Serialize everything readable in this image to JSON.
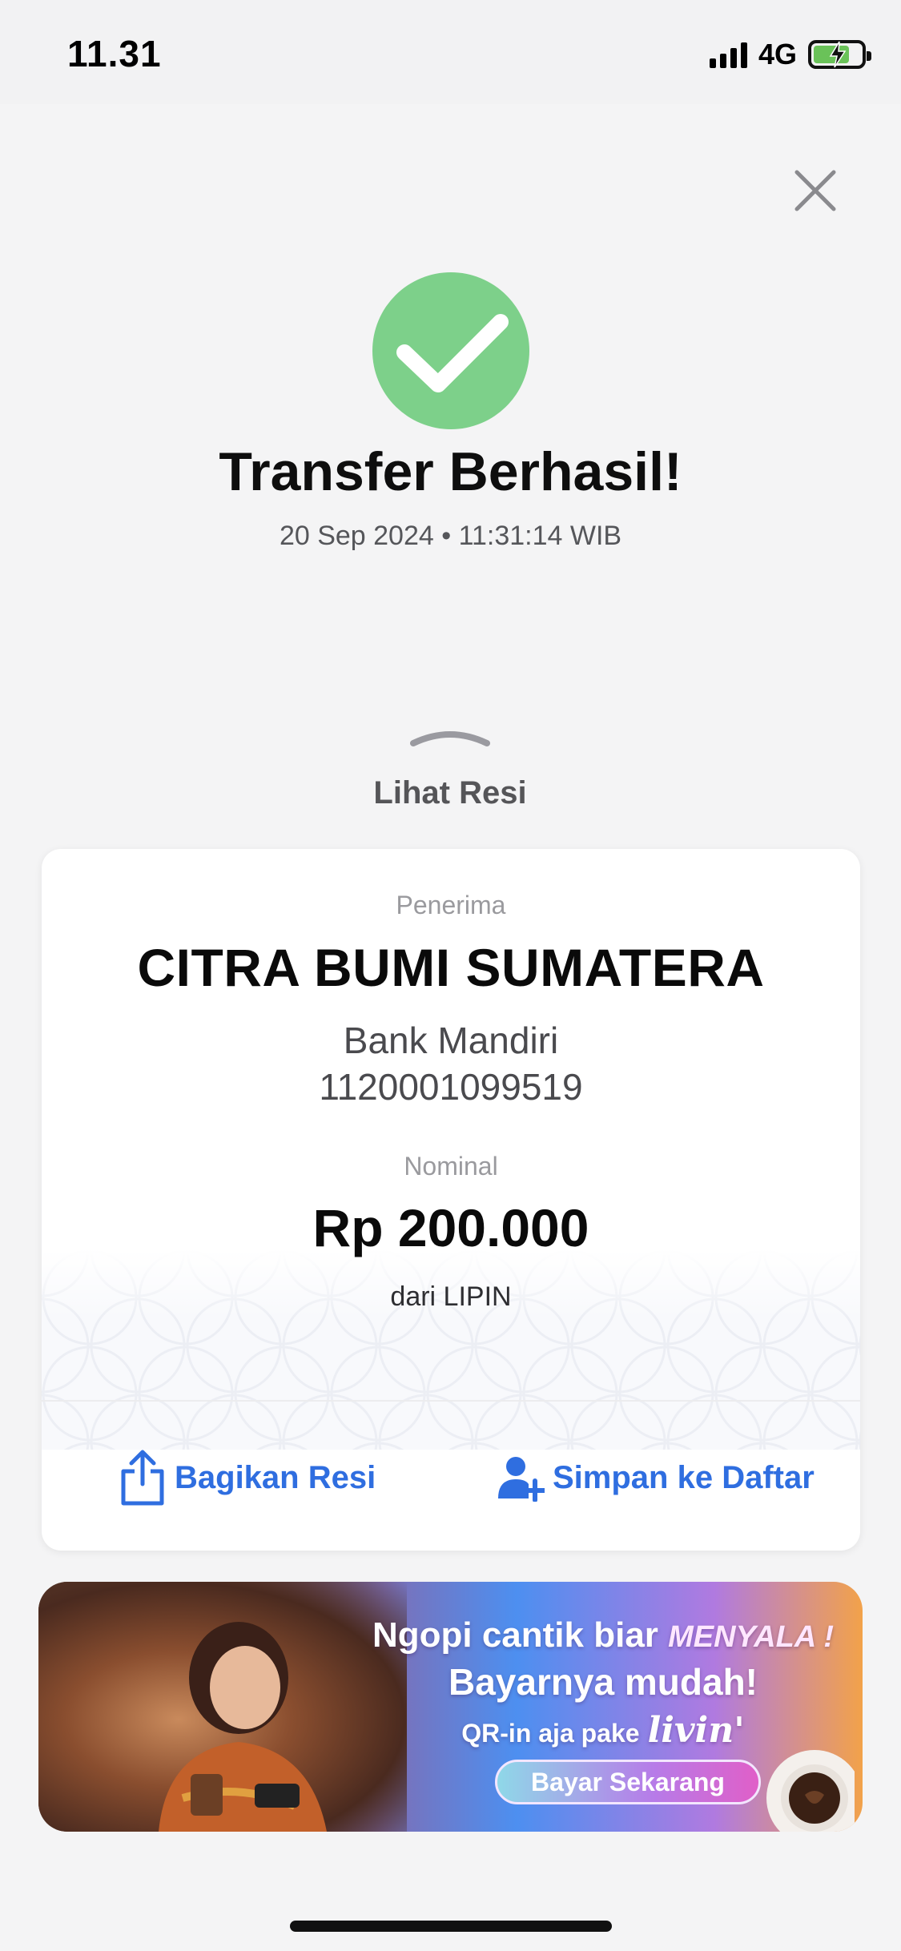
{
  "status_bar": {
    "time": "11.31",
    "network": "4G",
    "battery_icon": "battery-charging-icon",
    "signal_icon": "signal-bars-icon"
  },
  "header": {
    "close_icon": "close-icon"
  },
  "success": {
    "icon": "checkmark-circle-icon",
    "title": "Transfer Berhasil!",
    "datetime": "20 Sep 2024 • 11:31:14 WIB",
    "color": "#7dd08a"
  },
  "receipt_toggle": {
    "label": "Lihat Resi",
    "icon": "chevron-up-icon"
  },
  "receipt": {
    "recipient_label": "Penerima",
    "recipient_name": "CITRA BUMI SUMATERA",
    "bank": "Bank Mandiri",
    "account_number": "1120001099519",
    "amount_label": "Nominal",
    "amount": "Rp 200.000",
    "source": "dari LIPIN"
  },
  "actions": {
    "share_label": "Bagikan Resi",
    "share_icon": "share-icon",
    "save_label": "Simpan ke Daftar",
    "save_icon": "add-user-icon",
    "accent_color": "#2f6ee0"
  },
  "promo_banner": {
    "line1": "Ngopi cantik biar",
    "line1_emphasis": "MENYALA !",
    "line2": "Bayarnya mudah!",
    "line3": "QR-in aja pake",
    "brand": "livin'",
    "cta": "Bayar Sekarang"
  }
}
